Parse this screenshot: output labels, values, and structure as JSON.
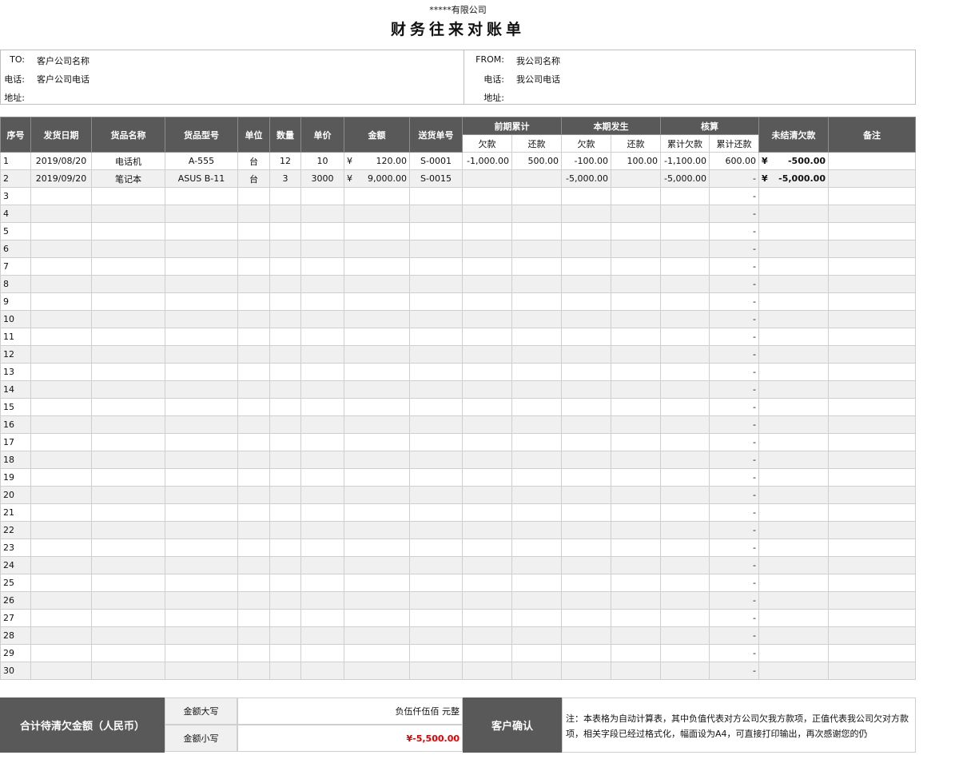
{
  "company_name": "*****有限公司",
  "title": "财务往来对账单",
  "to": {
    "label_to": "TO:",
    "company": "客户公司名称",
    "label_phone": "电话:",
    "phone": "客户公司电话",
    "label_addr": "地址:",
    "addr": ""
  },
  "from": {
    "label_from": "FROM:",
    "company": "我公司名称",
    "label_phone": "电话:",
    "phone": "我公司电话",
    "label_addr": "地址:",
    "addr": ""
  },
  "headers": {
    "seq": "序号",
    "date": "发货日期",
    "name": "货品名称",
    "model": "货品型号",
    "unit": "单位",
    "qty": "数量",
    "price": "单价",
    "amount": "金额",
    "delivery_no": "送货单号",
    "prior": "前期累计",
    "current": "本期发生",
    "reconcile": "核算",
    "owed": "欠款",
    "repaid": "还款",
    "cum_owed": "累计欠款",
    "cum_repaid": "累计还款",
    "outstanding": "未结清欠款",
    "remark": "备注"
  },
  "rows": [
    {
      "seq": "1",
      "date": "2019/08/20",
      "name": "电话机",
      "model": "A-555",
      "unit": "台",
      "qty": "12",
      "price": "10",
      "cur": "¥",
      "amount": "120.00",
      "delivery_no": "S-0001",
      "prior_owed": "-1,000.00",
      "prior_repaid": "500.00",
      "cur_owed": "-100.00",
      "cur_repaid": "100.00",
      "cum_owed": "-1,100.00",
      "cum_repaid": "600.00",
      "out_cur": "¥",
      "outstanding": "-500.00",
      "remark": ""
    },
    {
      "seq": "2",
      "date": "2019/09/20",
      "name": "笔记本",
      "model": "ASUS B-11",
      "unit": "台",
      "qty": "3",
      "price": "3000",
      "cur": "¥",
      "amount": "9,000.00",
      "delivery_no": "S-0015",
      "prior_owed": "",
      "prior_repaid": "",
      "cur_owed": "-5,000.00",
      "cur_repaid": "",
      "cum_owed": "-5,000.00",
      "cum_repaid": "-",
      "out_cur": "¥",
      "outstanding": "-5,000.00",
      "remark": ""
    },
    {
      "seq": "3",
      "date": "",
      "name": "",
      "model": "",
      "unit": "",
      "qty": "",
      "price": "",
      "cur": "",
      "amount": "",
      "delivery_no": "",
      "prior_owed": "",
      "prior_repaid": "",
      "cur_owed": "",
      "cur_repaid": "",
      "cum_owed": "",
      "cum_repaid": "-",
      "out_cur": "",
      "outstanding": "",
      "remark": ""
    },
    {
      "seq": "4",
      "date": "",
      "name": "",
      "model": "",
      "unit": "",
      "qty": "",
      "price": "",
      "cur": "",
      "amount": "",
      "delivery_no": "",
      "prior_owed": "",
      "prior_repaid": "",
      "cur_owed": "",
      "cur_repaid": "",
      "cum_owed": "",
      "cum_repaid": "-",
      "out_cur": "",
      "outstanding": "",
      "remark": ""
    },
    {
      "seq": "5",
      "date": "",
      "name": "",
      "model": "",
      "unit": "",
      "qty": "",
      "price": "",
      "cur": "",
      "amount": "",
      "delivery_no": "",
      "prior_owed": "",
      "prior_repaid": "",
      "cur_owed": "",
      "cur_repaid": "",
      "cum_owed": "",
      "cum_repaid": "-",
      "out_cur": "",
      "outstanding": "",
      "remark": ""
    },
    {
      "seq": "6",
      "date": "",
      "name": "",
      "model": "",
      "unit": "",
      "qty": "",
      "price": "",
      "cur": "",
      "amount": "",
      "delivery_no": "",
      "prior_owed": "",
      "prior_repaid": "",
      "cur_owed": "",
      "cur_repaid": "",
      "cum_owed": "",
      "cum_repaid": "-",
      "out_cur": "",
      "outstanding": "",
      "remark": ""
    },
    {
      "seq": "7",
      "date": "",
      "name": "",
      "model": "",
      "unit": "",
      "qty": "",
      "price": "",
      "cur": "",
      "amount": "",
      "delivery_no": "",
      "prior_owed": "",
      "prior_repaid": "",
      "cur_owed": "",
      "cur_repaid": "",
      "cum_owed": "",
      "cum_repaid": "-",
      "out_cur": "",
      "outstanding": "",
      "remark": ""
    },
    {
      "seq": "8",
      "date": "",
      "name": "",
      "model": "",
      "unit": "",
      "qty": "",
      "price": "",
      "cur": "",
      "amount": "",
      "delivery_no": "",
      "prior_owed": "",
      "prior_repaid": "",
      "cur_owed": "",
      "cur_repaid": "",
      "cum_owed": "",
      "cum_repaid": "-",
      "out_cur": "",
      "outstanding": "",
      "remark": ""
    },
    {
      "seq": "9",
      "date": "",
      "name": "",
      "model": "",
      "unit": "",
      "qty": "",
      "price": "",
      "cur": "",
      "amount": "",
      "delivery_no": "",
      "prior_owed": "",
      "prior_repaid": "",
      "cur_owed": "",
      "cur_repaid": "",
      "cum_owed": "",
      "cum_repaid": "-",
      "out_cur": "",
      "outstanding": "",
      "remark": ""
    },
    {
      "seq": "10",
      "date": "",
      "name": "",
      "model": "",
      "unit": "",
      "qty": "",
      "price": "",
      "cur": "",
      "amount": "",
      "delivery_no": "",
      "prior_owed": "",
      "prior_repaid": "",
      "cur_owed": "",
      "cur_repaid": "",
      "cum_owed": "",
      "cum_repaid": "-",
      "out_cur": "",
      "outstanding": "",
      "remark": ""
    },
    {
      "seq": "11",
      "date": "",
      "name": "",
      "model": "",
      "unit": "",
      "qty": "",
      "price": "",
      "cur": "",
      "amount": "",
      "delivery_no": "",
      "prior_owed": "",
      "prior_repaid": "",
      "cur_owed": "",
      "cur_repaid": "",
      "cum_owed": "",
      "cum_repaid": "-",
      "out_cur": "",
      "outstanding": "",
      "remark": ""
    },
    {
      "seq": "12",
      "date": "",
      "name": "",
      "model": "",
      "unit": "",
      "qty": "",
      "price": "",
      "cur": "",
      "amount": "",
      "delivery_no": "",
      "prior_owed": "",
      "prior_repaid": "",
      "cur_owed": "",
      "cur_repaid": "",
      "cum_owed": "",
      "cum_repaid": "-",
      "out_cur": "",
      "outstanding": "",
      "remark": ""
    },
    {
      "seq": "13",
      "date": "",
      "name": "",
      "model": "",
      "unit": "",
      "qty": "",
      "price": "",
      "cur": "",
      "amount": "",
      "delivery_no": "",
      "prior_owed": "",
      "prior_repaid": "",
      "cur_owed": "",
      "cur_repaid": "",
      "cum_owed": "",
      "cum_repaid": "-",
      "out_cur": "",
      "outstanding": "",
      "remark": ""
    },
    {
      "seq": "14",
      "date": "",
      "name": "",
      "model": "",
      "unit": "",
      "qty": "",
      "price": "",
      "cur": "",
      "amount": "",
      "delivery_no": "",
      "prior_owed": "",
      "prior_repaid": "",
      "cur_owed": "",
      "cur_repaid": "",
      "cum_owed": "",
      "cum_repaid": "-",
      "out_cur": "",
      "outstanding": "",
      "remark": ""
    },
    {
      "seq": "15",
      "date": "",
      "name": "",
      "model": "",
      "unit": "",
      "qty": "",
      "price": "",
      "cur": "",
      "amount": "",
      "delivery_no": "",
      "prior_owed": "",
      "prior_repaid": "",
      "cur_owed": "",
      "cur_repaid": "",
      "cum_owed": "",
      "cum_repaid": "-",
      "out_cur": "",
      "outstanding": "",
      "remark": ""
    },
    {
      "seq": "16",
      "date": "",
      "name": "",
      "model": "",
      "unit": "",
      "qty": "",
      "price": "",
      "cur": "",
      "amount": "",
      "delivery_no": "",
      "prior_owed": "",
      "prior_repaid": "",
      "cur_owed": "",
      "cur_repaid": "",
      "cum_owed": "",
      "cum_repaid": "-",
      "out_cur": "",
      "outstanding": "",
      "remark": ""
    },
    {
      "seq": "17",
      "date": "",
      "name": "",
      "model": "",
      "unit": "",
      "qty": "",
      "price": "",
      "cur": "",
      "amount": "",
      "delivery_no": "",
      "prior_owed": "",
      "prior_repaid": "",
      "cur_owed": "",
      "cur_repaid": "",
      "cum_owed": "",
      "cum_repaid": "-",
      "out_cur": "",
      "outstanding": "",
      "remark": ""
    },
    {
      "seq": "18",
      "date": "",
      "name": "",
      "model": "",
      "unit": "",
      "qty": "",
      "price": "",
      "cur": "",
      "amount": "",
      "delivery_no": "",
      "prior_owed": "",
      "prior_repaid": "",
      "cur_owed": "",
      "cur_repaid": "",
      "cum_owed": "",
      "cum_repaid": "-",
      "out_cur": "",
      "outstanding": "",
      "remark": ""
    },
    {
      "seq": "19",
      "date": "",
      "name": "",
      "model": "",
      "unit": "",
      "qty": "",
      "price": "",
      "cur": "",
      "amount": "",
      "delivery_no": "",
      "prior_owed": "",
      "prior_repaid": "",
      "cur_owed": "",
      "cur_repaid": "",
      "cum_owed": "",
      "cum_repaid": "-",
      "out_cur": "",
      "outstanding": "",
      "remark": ""
    },
    {
      "seq": "20",
      "date": "",
      "name": "",
      "model": "",
      "unit": "",
      "qty": "",
      "price": "",
      "cur": "",
      "amount": "",
      "delivery_no": "",
      "prior_owed": "",
      "prior_repaid": "",
      "cur_owed": "",
      "cur_repaid": "",
      "cum_owed": "",
      "cum_repaid": "-",
      "out_cur": "",
      "outstanding": "",
      "remark": ""
    },
    {
      "seq": "21",
      "date": "",
      "name": "",
      "model": "",
      "unit": "",
      "qty": "",
      "price": "",
      "cur": "",
      "amount": "",
      "delivery_no": "",
      "prior_owed": "",
      "prior_repaid": "",
      "cur_owed": "",
      "cur_repaid": "",
      "cum_owed": "",
      "cum_repaid": "-",
      "out_cur": "",
      "outstanding": "",
      "remark": ""
    },
    {
      "seq": "22",
      "date": "",
      "name": "",
      "model": "",
      "unit": "",
      "qty": "",
      "price": "",
      "cur": "",
      "amount": "",
      "delivery_no": "",
      "prior_owed": "",
      "prior_repaid": "",
      "cur_owed": "",
      "cur_repaid": "",
      "cum_owed": "",
      "cum_repaid": "-",
      "out_cur": "",
      "outstanding": "",
      "remark": ""
    },
    {
      "seq": "23",
      "date": "",
      "name": "",
      "model": "",
      "unit": "",
      "qty": "",
      "price": "",
      "cur": "",
      "amount": "",
      "delivery_no": "",
      "prior_owed": "",
      "prior_repaid": "",
      "cur_owed": "",
      "cur_repaid": "",
      "cum_owed": "",
      "cum_repaid": "-",
      "out_cur": "",
      "outstanding": "",
      "remark": ""
    },
    {
      "seq": "24",
      "date": "",
      "name": "",
      "model": "",
      "unit": "",
      "qty": "",
      "price": "",
      "cur": "",
      "amount": "",
      "delivery_no": "",
      "prior_owed": "",
      "prior_repaid": "",
      "cur_owed": "",
      "cur_repaid": "",
      "cum_owed": "",
      "cum_repaid": "-",
      "out_cur": "",
      "outstanding": "",
      "remark": ""
    },
    {
      "seq": "25",
      "date": "",
      "name": "",
      "model": "",
      "unit": "",
      "qty": "",
      "price": "",
      "cur": "",
      "amount": "",
      "delivery_no": "",
      "prior_owed": "",
      "prior_repaid": "",
      "cur_owed": "",
      "cur_repaid": "",
      "cum_owed": "",
      "cum_repaid": "-",
      "out_cur": "",
      "outstanding": "",
      "remark": ""
    },
    {
      "seq": "26",
      "date": "",
      "name": "",
      "model": "",
      "unit": "",
      "qty": "",
      "price": "",
      "cur": "",
      "amount": "",
      "delivery_no": "",
      "prior_owed": "",
      "prior_repaid": "",
      "cur_owed": "",
      "cur_repaid": "",
      "cum_owed": "",
      "cum_repaid": "-",
      "out_cur": "",
      "outstanding": "",
      "remark": ""
    },
    {
      "seq": "27",
      "date": "",
      "name": "",
      "model": "",
      "unit": "",
      "qty": "",
      "price": "",
      "cur": "",
      "amount": "",
      "delivery_no": "",
      "prior_owed": "",
      "prior_repaid": "",
      "cur_owed": "",
      "cur_repaid": "",
      "cum_owed": "",
      "cum_repaid": "-",
      "out_cur": "",
      "outstanding": "",
      "remark": ""
    },
    {
      "seq": "28",
      "date": "",
      "name": "",
      "model": "",
      "unit": "",
      "qty": "",
      "price": "",
      "cur": "",
      "amount": "",
      "delivery_no": "",
      "prior_owed": "",
      "prior_repaid": "",
      "cur_owed": "",
      "cur_repaid": "",
      "cum_owed": "",
      "cum_repaid": "-",
      "out_cur": "",
      "outstanding": "",
      "remark": ""
    },
    {
      "seq": "29",
      "date": "",
      "name": "",
      "model": "",
      "unit": "",
      "qty": "",
      "price": "",
      "cur": "",
      "amount": "",
      "delivery_no": "",
      "prior_owed": "",
      "prior_repaid": "",
      "cur_owed": "",
      "cur_repaid": "",
      "cum_owed": "",
      "cum_repaid": "-",
      "out_cur": "",
      "outstanding": "",
      "remark": ""
    },
    {
      "seq": "30",
      "date": "",
      "name": "",
      "model": "",
      "unit": "",
      "qty": "",
      "price": "",
      "cur": "",
      "amount": "",
      "delivery_no": "",
      "prior_owed": "",
      "prior_repaid": "",
      "cur_owed": "",
      "cur_repaid": "",
      "cum_owed": "",
      "cum_repaid": "-",
      "out_cur": "",
      "outstanding": "",
      "remark": ""
    }
  ],
  "footer": {
    "total_label": "合计待清欠金额（人民币）",
    "upper_label": "金额大写",
    "upper_value": "负伍仟伍佰 元整",
    "lower_label": "金额小写",
    "lower_value": "¥-5,500.00",
    "confirm_label": "客户确认",
    "note": "注：本表格为自动计算表，其中负值代表对方公司欠我方款项，正值代表我公司欠对方款项，相关字段已经过格式化，幅面设为A4，可直接打印输出，再次感谢您的仍"
  },
  "colors": {
    "header_bg": "#595959",
    "stripe": "#f0f0f0",
    "negative_total": "#e00000"
  }
}
